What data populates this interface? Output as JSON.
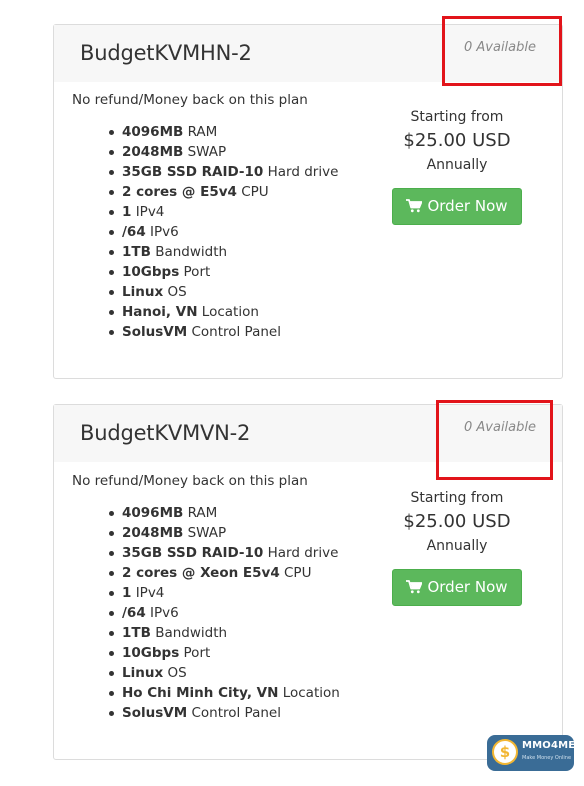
{
  "plans": [
    {
      "title": "BudgetKVMHN-2",
      "availability": "0 Available",
      "refund_note": "No refund/Money back on this plan",
      "features": [
        {
          "bold": "4096MB",
          "text": " RAM"
        },
        {
          "bold": "2048MB",
          "text": " SWAP"
        },
        {
          "bold": "35GB SSD RAID-10",
          "text": " Hard drive"
        },
        {
          "bold": "2 cores @ E5v4",
          "text": " CPU"
        },
        {
          "bold": "1",
          "text": " IPv4"
        },
        {
          "bold": "/64",
          "text": " IPv6"
        },
        {
          "bold": "1TB",
          "text": " Bandwidth"
        },
        {
          "bold": "10Gbps",
          "text": " Port"
        },
        {
          "bold": "Linux",
          "text": " OS"
        },
        {
          "bold": "Hanoi, VN",
          "text": " Location"
        },
        {
          "bold": "SolusVM",
          "text": " Control Panel"
        }
      ],
      "starting_label": "Starting from",
      "price": "$25.00 USD",
      "billing_cycle": "Annually",
      "order_label": "Order Now"
    },
    {
      "title": "BudgetKVMVN-2",
      "availability": "0 Available",
      "refund_note": "No refund/Money back on this plan",
      "features": [
        {
          "bold": "4096MB",
          "text": " RAM"
        },
        {
          "bold": "2048MB",
          "text": " SWAP"
        },
        {
          "bold": "35GB SSD RAID-10",
          "text": " Hard drive"
        },
        {
          "bold": "2 cores @ Xeon E5v4",
          "text": " CPU"
        },
        {
          "bold": "1",
          "text": " IPv4"
        },
        {
          "bold": "/64",
          "text": " IPv6"
        },
        {
          "bold": "1TB",
          "text": " Bandwidth"
        },
        {
          "bold": "10Gbps",
          "text": " Port"
        },
        {
          "bold": "Linux",
          "text": " OS"
        },
        {
          "bold": "Ho Chi Minh City, VN",
          "text": " Location"
        },
        {
          "bold": "SolusVM",
          "text": " Control Panel"
        }
      ],
      "starting_label": "Starting from",
      "price": "$25.00 USD",
      "billing_cycle": "Annually",
      "order_label": "Order Now"
    }
  ],
  "watermark": {
    "name": "MMO4ME",
    "tagline": "Make Money Online",
    "symbol": "$"
  },
  "colors": {
    "order_button": "#5cb85c",
    "highlight_box": "#e2141a",
    "watermark_bg": "#3a6c96"
  },
  "icons": {
    "order_button": "shopping-cart-icon",
    "watermark": "dollar-coin-icon"
  }
}
